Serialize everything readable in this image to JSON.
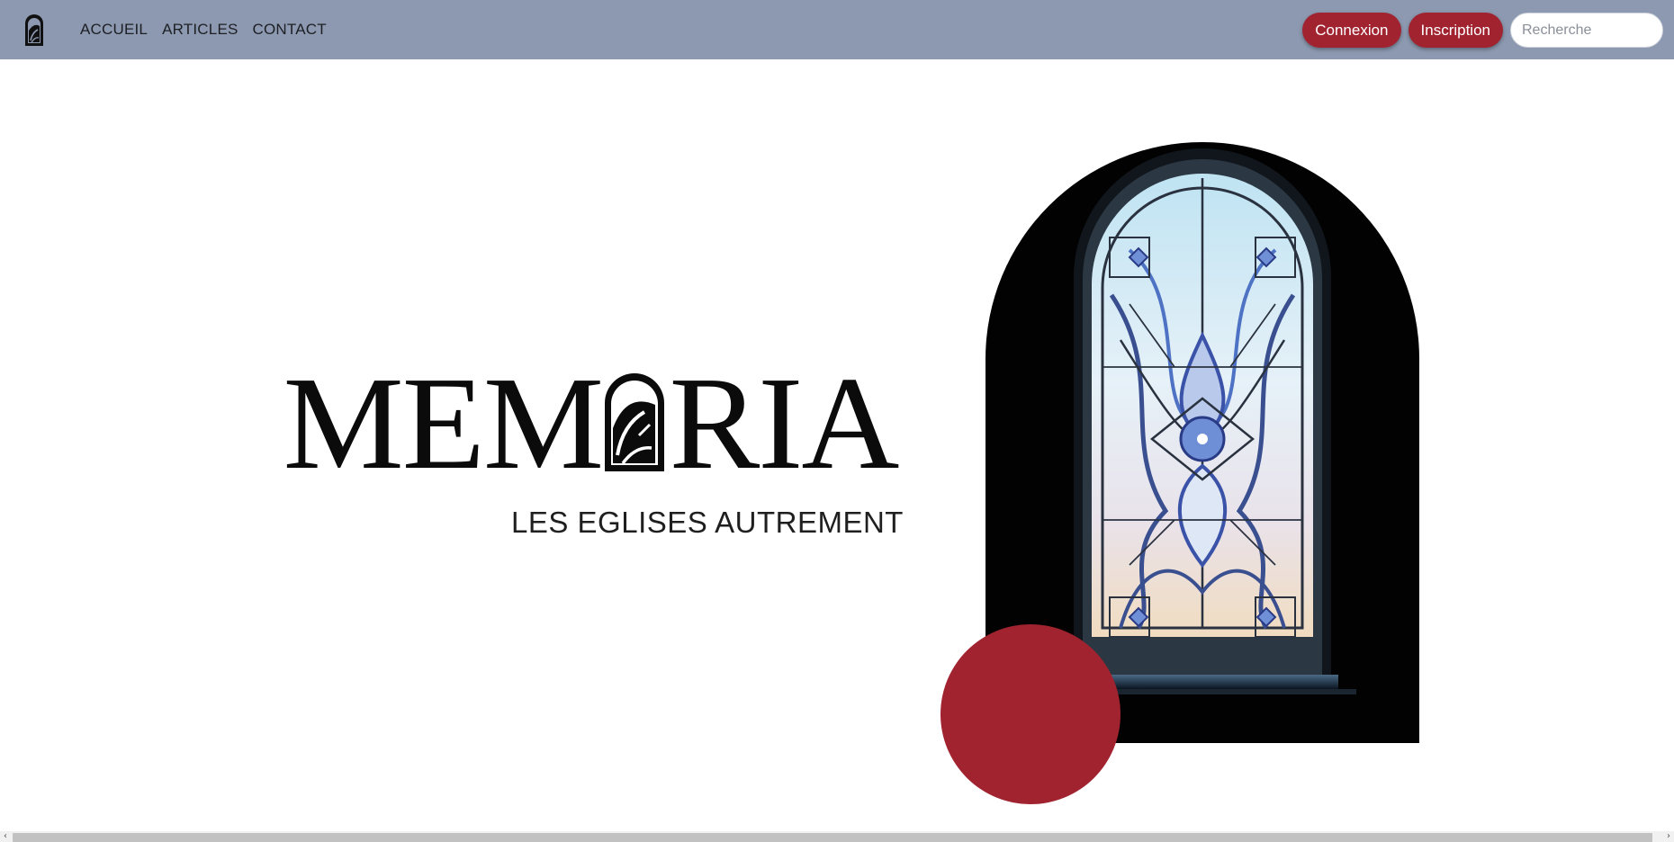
{
  "nav": {
    "logo_icon": "stained-glass-arch-logo-icon",
    "links": [
      "ACCUEIL",
      "ARTICLES",
      "CONTACT"
    ],
    "login_label": "Connexion",
    "signup_label": "Inscription",
    "search_placeholder": "Recherche"
  },
  "hero": {
    "title_left": "MEM",
    "title_right": "RIA",
    "title_o_icon": "arch-window-letter-o-icon",
    "tagline": "LES EGLISES AUTREMENT",
    "image_icon": "stained-glass-window-image"
  },
  "colors": {
    "navbar_bg": "#8c99b0",
    "accent_red": "#a1232f",
    "text_dark": "#0b0b0b",
    "page_bg": "#ffffff"
  }
}
